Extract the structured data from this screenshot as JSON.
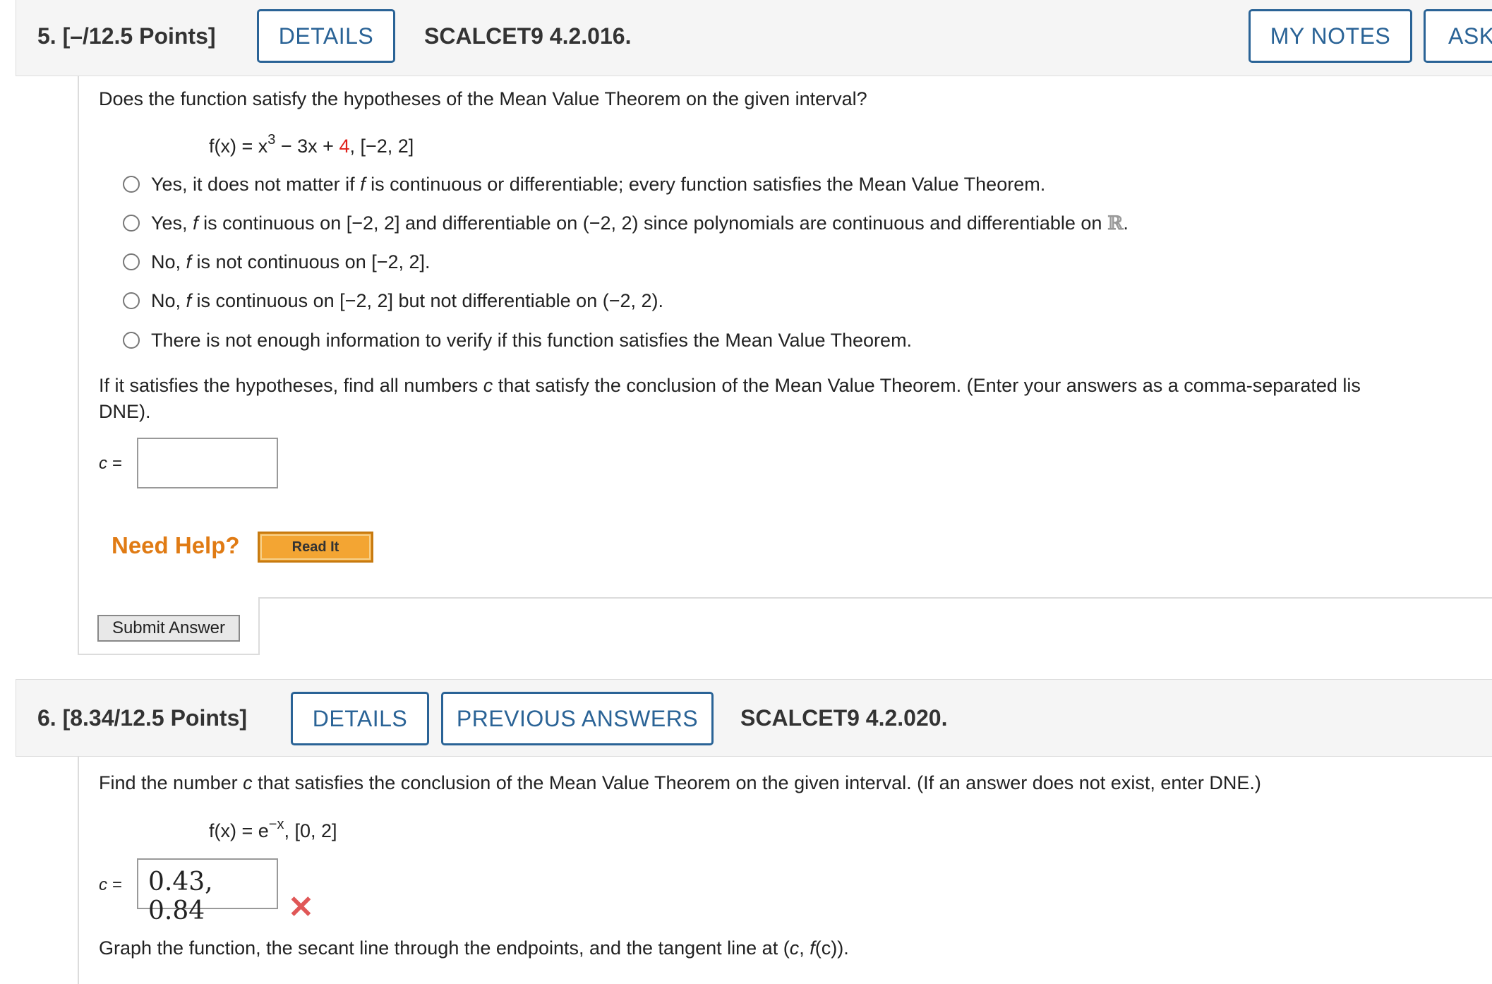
{
  "q5": {
    "number": "5.",
    "points": "[–/12.5 Points]",
    "details_label": "DETAILS",
    "code": "SCALCET9 4.2.016.",
    "my_notes_label": "MY NOTES",
    "ask_label": "ASK",
    "prompt": "Does the function satisfy the hypotheses of the Mean Value Theorem on the given interval?",
    "function": {
      "lhs": "f(x) = x",
      "exp": "3",
      "mid": " − 3x + ",
      "const": "4",
      "rest": ",    [−2, 2]"
    },
    "options": [
      {
        "a": "Yes, it does not matter if ",
        "f": "f",
        "b": " is continuous or differentiable; every function satisfies the Mean Value Theorem."
      },
      {
        "a": "Yes, ",
        "f": "f",
        "b": " is continuous on [−2, 2] and differentiable on (−2, 2) since polynomials are continuous and differentiable on ",
        "reals": "ℝ",
        "end": "."
      },
      {
        "a": "No, ",
        "f": "f",
        "b": " is not continuous on [−2, 2]."
      },
      {
        "a": "No, ",
        "f": "f",
        "b": " is continuous on [−2, 2] but not differentiable on (−2, 2)."
      },
      {
        "a": "There is not enough information to verify if this function satisfies the Mean Value Theorem.",
        "f": "",
        "b": ""
      }
    ],
    "conclusion_line1_a": "If it satisfies the hypotheses, find all numbers ",
    "conclusion_c": "c",
    "conclusion_line1_b": " that satisfy the conclusion of the Mean Value Theorem. (Enter your answers as a comma-separated lis",
    "conclusion_line2": "DNE).",
    "c_label": "c =",
    "c_value": "",
    "need_help": "Need Help?",
    "read_it": "Read It",
    "submit": "Submit Answer"
  },
  "q6": {
    "number": "6.",
    "points": "[8.34/12.5 Points]",
    "details_label": "DETAILS",
    "previous_answers_label": "PREVIOUS ANSWERS",
    "code": "SCALCET9 4.2.020.",
    "prompt_a": "Find the number ",
    "prompt_c": "c",
    "prompt_b": " that satisfies the conclusion of the Mean Value Theorem on the given interval. (If an answer does not exist, enter DNE.)",
    "function": {
      "lhs": "f(x) = e",
      "exp": "−x",
      "rest": ",    [0, 2]"
    },
    "c_label": "c =",
    "c_value": "0.43, 0.84",
    "status_icon": "incorrect-x-icon",
    "graph_a": "Graph the function, the secant line through the endpoints, and the tangent line at (",
    "graph_c": "c",
    "graph_mid": ", ",
    "graph_fc": "f",
    "graph_b": "(c))."
  },
  "colors": {
    "accent": "#2a6396",
    "need_help": "#e07b14",
    "red": "#e0211b",
    "incorrect": "#e05757"
  }
}
